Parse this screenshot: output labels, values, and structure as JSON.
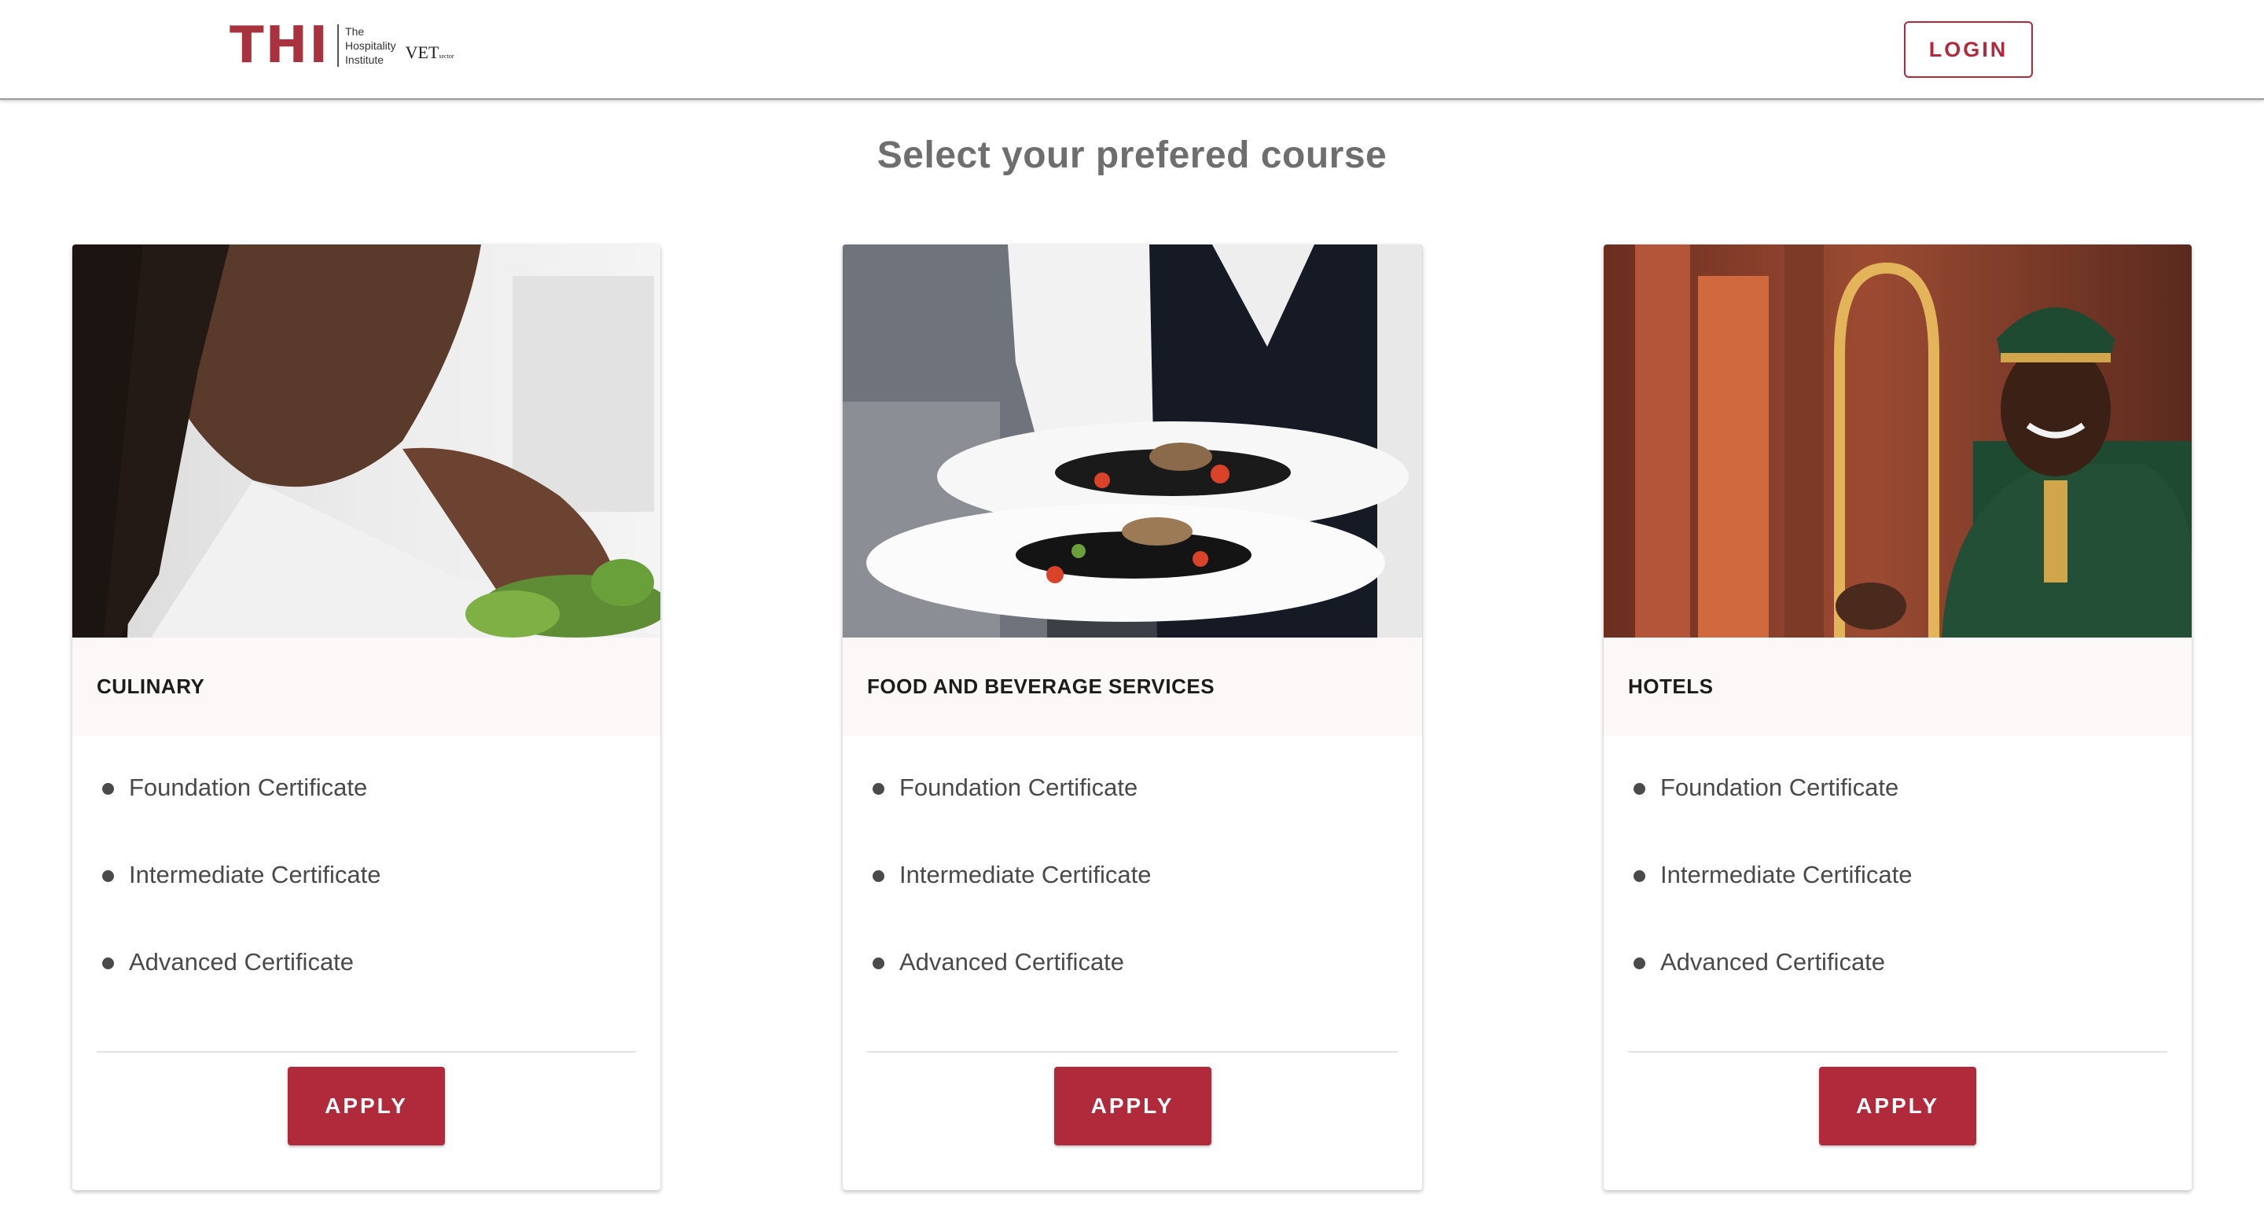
{
  "header": {
    "logo": {
      "mark": "THI",
      "line1": "The",
      "line2": "Hospitality",
      "line3": "Institute",
      "partner": "VET",
      "partner_small": "sector"
    },
    "login_label": "LOGIN"
  },
  "page_title": "Select your prefered course",
  "courses": [
    {
      "title": "CULINARY",
      "image_subject": "chef plating salad greens",
      "certificates": [
        "Foundation Certificate",
        "Intermediate Certificate",
        "Advanced Certificate"
      ],
      "apply_label": "APPLY"
    },
    {
      "title": "FOOD AND BEVERAGE SERVICES",
      "image_subject": "waiter holding two plated dishes",
      "certificates": [
        "Foundation Certificate",
        "Intermediate Certificate",
        "Advanced Certificate"
      ],
      "apply_label": "APPLY"
    },
    {
      "title": "HOTELS",
      "image_subject": "smiling hotel bellhop with luggage cart",
      "certificates": [
        "Foundation Certificate",
        "Intermediate Certificate",
        "Advanced Certificate"
      ],
      "apply_label": "APPLY"
    }
  ],
  "colors": {
    "brand": "#b02a3c",
    "logo_red": "#a8333f",
    "title_gray": "#6e6e6e",
    "card_header_bg": "#fcf8f8"
  }
}
